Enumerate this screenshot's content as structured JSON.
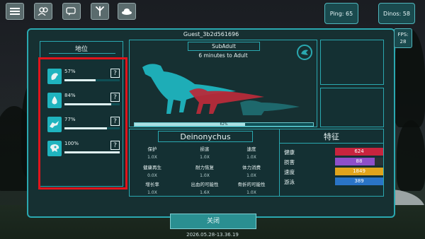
{
  "hud": {
    "ping_text": "Ping: 65",
    "dinos_text": "Dinos: 58",
    "fps_label": "FPS:",
    "fps_value": "28"
  },
  "menu_icons": [
    "menu-icon",
    "group-icon",
    "chat-icon",
    "footprint-icon",
    "nest-icon"
  ],
  "panel": {
    "player_name": "Guest_3b2d561696",
    "growth_stage": "SubAdult",
    "growth_time": "6 minutes to Adult",
    "growth_progress_text": "62%",
    "growth_progress": 0.62,
    "species": "Deinonychus"
  },
  "rank": {
    "title": "地位",
    "items": [
      {
        "icon": "hunger-icon",
        "pct_text": "57%",
        "value": 0.57,
        "help": "?"
      },
      {
        "icon": "thirst-icon",
        "pct_text": "84%",
        "value": 0.84,
        "help": "?"
      },
      {
        "icon": "stamina-icon",
        "pct_text": "77%",
        "value": 0.77,
        "help": "?"
      },
      {
        "icon": "skull-icon",
        "pct_text": "100%",
        "value": 1.0,
        "help": "?"
      }
    ]
  },
  "multipliers": [
    {
      "label": "保护",
      "value": "1.0X"
    },
    {
      "label": "损害",
      "value": "1.0X"
    },
    {
      "label": "速度",
      "value": "1.0X"
    },
    {
      "label": "健康再生",
      "value": "0.0X"
    },
    {
      "label": "耐力恢复",
      "value": "1.0X"
    },
    {
      "label": "体力消费",
      "value": "1.0X"
    },
    {
      "label": "增长率",
      "value": "1.0X"
    },
    {
      "label": "出血的可能性",
      "value": "1.6X"
    },
    {
      "label": "骨折的可能性",
      "value": "1.0X"
    }
  ],
  "traits": {
    "title": "特征",
    "items": [
      {
        "label": "健康",
        "value": "624",
        "color": "#c8243e",
        "fill": 1.0
      },
      {
        "label": "损害",
        "value": "88",
        "color": "#8e4fc9",
        "fill": 0.82
      },
      {
        "label": "速度",
        "value": "1849",
        "color": "#e0a41c",
        "fill": 1.0
      },
      {
        "label": "游泳",
        "value": "389",
        "color": "#2a74c6",
        "fill": 1.0
      }
    ]
  },
  "close_label": "关闭",
  "timestamp": "2026.05.28-13.36.19",
  "colors": {
    "accent": "#2aa8b0",
    "dino_primary": "#1fb4bf",
    "dino_secondary": "#b72b3a"
  }
}
